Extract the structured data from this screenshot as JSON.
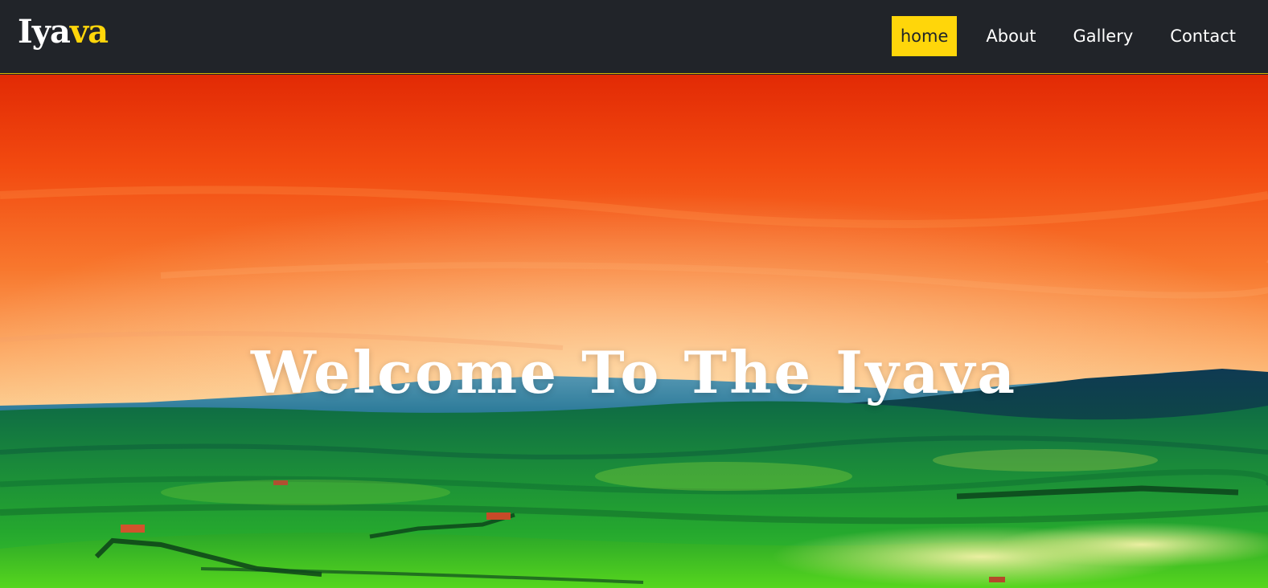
{
  "header": {
    "logo_part1": "Iya",
    "logo_part2": "va"
  },
  "nav": {
    "items": [
      {
        "label": "home",
        "active": true
      },
      {
        "label": "About",
        "active": false
      },
      {
        "label": "Gallery",
        "active": false
      },
      {
        "label": "Contact",
        "active": false
      }
    ]
  },
  "hero": {
    "title": "Welcome To The Iyava"
  },
  "colors": {
    "navbar_bg": "#212429",
    "accent": "#ffd60a",
    "text": "#ffffff"
  }
}
